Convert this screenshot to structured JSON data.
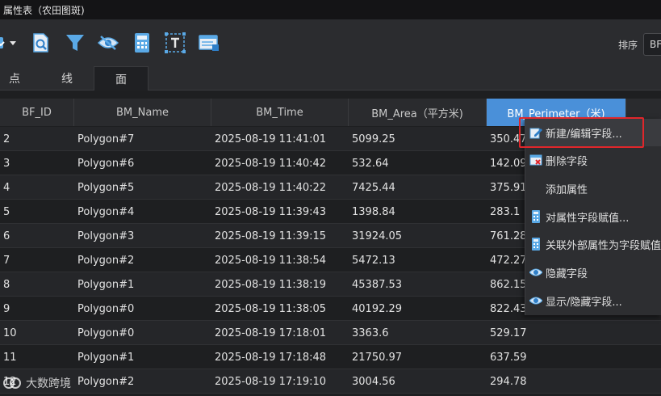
{
  "window": {
    "title": "属性表（农田图斑)"
  },
  "toolbar": {
    "icons": [
      "export-dropdown-icon",
      "search-document-icon",
      "filter-icon",
      "hide-eye-icon",
      "calculator-icon",
      "text-field-icon",
      "table-view-icon"
    ],
    "sort_label": "排序",
    "sort_value": "BF"
  },
  "tabs": [
    {
      "label": "点",
      "active": false
    },
    {
      "label": "线",
      "active": false
    },
    {
      "label": "面",
      "active": true
    }
  ],
  "table": {
    "columns": [
      "BF_ID",
      "BM_Name",
      "BM_Time",
      "BM_Area（平方米)",
      "BM_Perimeter（米)"
    ],
    "selected_column": 4,
    "rows": [
      [
        "2",
        "Polygon#7",
        "2025-08-19 11:41:01",
        "5099.25",
        "350.47"
      ],
      [
        "3",
        "Polygon#6",
        "2025-08-19 11:40:42",
        "532.64",
        "142.09"
      ],
      [
        "4",
        "Polygon#5",
        "2025-08-19 11:40:22",
        "7425.44",
        "375.91"
      ],
      [
        "5",
        "Polygon#4",
        "2025-08-19 11:39:43",
        "1398.84",
        "283.1"
      ],
      [
        "6",
        "Polygon#3",
        "2025-08-19 11:39:15",
        "31924.05",
        "761.28"
      ],
      [
        "7",
        "Polygon#2",
        "2025-08-19 11:38:54",
        "5472.13",
        "472.27"
      ],
      [
        "8",
        "Polygon#1",
        "2025-08-19 11:38:19",
        "45387.53",
        "862.15"
      ],
      [
        "9",
        "Polygon#0",
        "2025-08-19 11:38:05",
        "40192.29",
        "822.43"
      ],
      [
        "10",
        "Polygon#0",
        "2025-08-19 17:18:01",
        "3363.6",
        "529.17"
      ],
      [
        "11",
        "Polygon#1",
        "2025-08-19 17:18:48",
        "21750.97",
        "637.59"
      ],
      [
        "12",
        "Polygon#2",
        "2025-08-19 17:19:10",
        "3004.56",
        "294.78"
      ]
    ]
  },
  "context_menu": {
    "items": [
      {
        "label": "新建/编辑字段...",
        "icon": "edit-field-icon"
      },
      {
        "label": "删除字段",
        "icon": "delete-field-icon"
      },
      {
        "label": "添加属性",
        "icon": ""
      },
      {
        "label": "对属性字段赋值...",
        "icon": "calculator-icon"
      },
      {
        "label": "关联外部属性为字段赋值",
        "icon": "calculator-icon"
      },
      {
        "label": "隐藏字段",
        "icon": "eye-icon"
      },
      {
        "label": "显示/隐藏字段...",
        "icon": "eye-icon"
      }
    ]
  },
  "watermark": {
    "text": "大数跨境"
  },
  "colors": {
    "accent": "#4a90d9",
    "highlight_box": "#e0262b",
    "icon_blue": "#5aa9e6"
  }
}
